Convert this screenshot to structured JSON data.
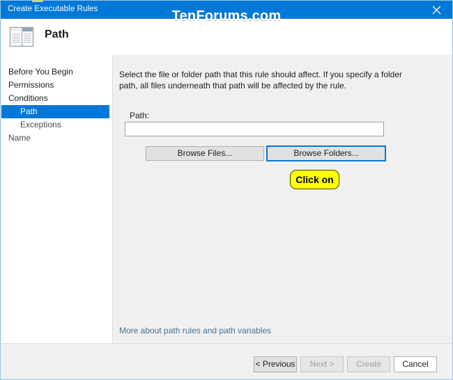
{
  "window": {
    "title": "Create Executable Rules",
    "close_icon": "close-icon",
    "watermark": "TenForums.com",
    "accent_color": "#0078d7",
    "panel_color": "#f0f0f0"
  },
  "header": {
    "icon": "window-panes-icon",
    "title": "Path"
  },
  "sidebar": {
    "items": [
      {
        "label": "Before You Begin",
        "level": 0,
        "selected": false
      },
      {
        "label": "Permissions",
        "level": 0,
        "selected": false
      },
      {
        "label": "Conditions",
        "level": 0,
        "selected": false
      },
      {
        "label": "Path",
        "level": 1,
        "selected": true
      },
      {
        "label": "Exceptions",
        "level": 1,
        "selected": false
      },
      {
        "label": "Name",
        "level": 0,
        "selected": false
      }
    ]
  },
  "main": {
    "description": "Select the file or folder path that this rule should affect. If you specify a folder path, all files underneath that path will be affected by the rule.",
    "path_label": "Path:",
    "path_value": "",
    "path_placeholder": "",
    "browse_files_label": "Browse Files...",
    "browse_folders_label": "Browse Folders...",
    "more_link_label": "More about path rules and path variables"
  },
  "callout": {
    "text": "Click on",
    "fill_color": "#ffff00"
  },
  "buttons": {
    "previous": {
      "label": "< Previous",
      "disabled": false
    },
    "next": {
      "label": "Next >",
      "disabled": true
    },
    "create": {
      "label": "Create",
      "disabled": true
    },
    "cancel": {
      "label": "Cancel",
      "disabled": false
    }
  }
}
